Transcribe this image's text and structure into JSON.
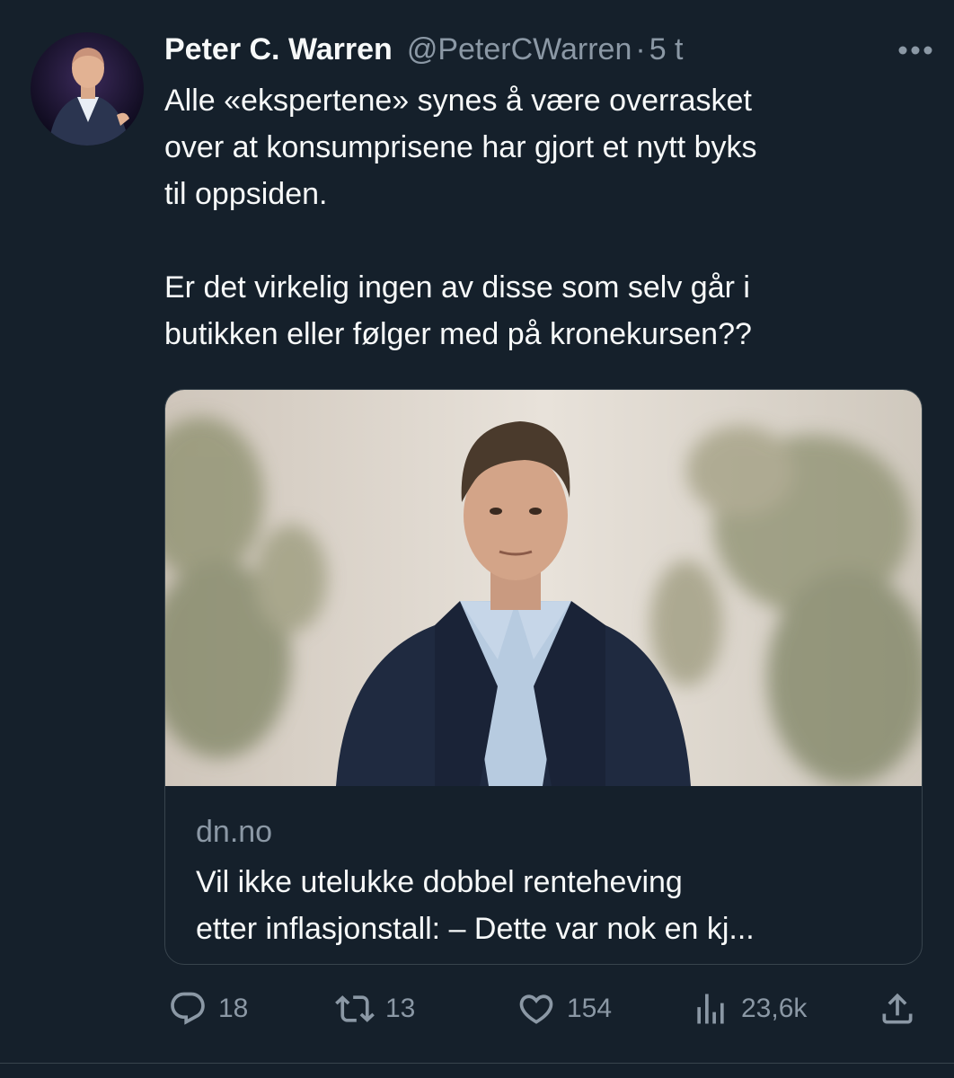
{
  "tweet": {
    "display_name": "Peter C. Warren",
    "handle": "@PeterCWarren",
    "separator": "·",
    "time": "5 t",
    "text_lines": [
      "Alle «ekspertene» synes å være overrasket",
      "over at konsumprisene har gjort et nytt byks",
      "til oppsiden.",
      "Er det virkelig ingen av disse som selv går i",
      "butikken eller følger med på kronekursen??"
    ]
  },
  "card": {
    "domain": "dn.no",
    "headline_lines": [
      "Vil ikke utelukke dobbel renteheving",
      "etter inflasjonstall: – Dette var nok en kj..."
    ]
  },
  "actions": {
    "replies": "18",
    "retweets": "13",
    "likes": "154",
    "views": "23,6k"
  },
  "icons": {
    "more": "more-horizontal-icon",
    "reply": "reply-icon",
    "retweet": "retweet-icon",
    "like": "heart-icon",
    "views": "views-icon",
    "share": "share-icon"
  },
  "colors": {
    "background": "#15202b",
    "text": "#f7f9f9",
    "secondary_text": "#8b98a5",
    "border": "#38444d"
  }
}
